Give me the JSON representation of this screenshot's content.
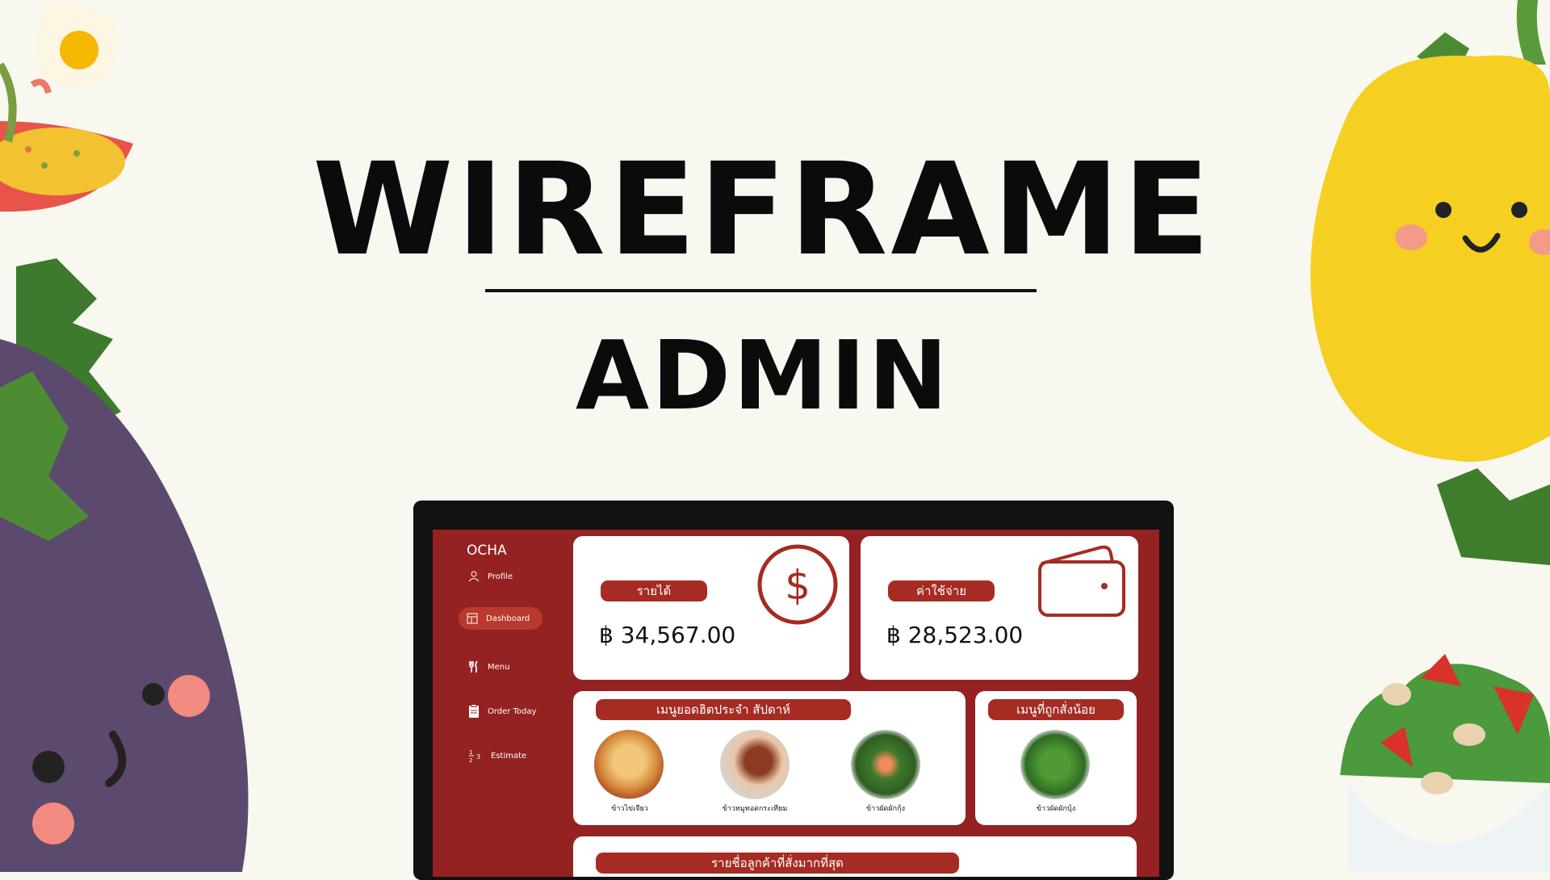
{
  "hero": {
    "title": "WIREFRAME",
    "subtitle": "ADMIN"
  },
  "app": {
    "brand": "OCHA"
  },
  "sidebar": {
    "items": [
      {
        "label": "Profile",
        "icon": "person-icon"
      },
      {
        "label": "Dashboard",
        "icon": "dashboard-icon",
        "active": true
      },
      {
        "label": "Menu",
        "icon": "fork-knife-icon"
      },
      {
        "label": "Order Today",
        "icon": "clipboard-icon"
      },
      {
        "label": "Estimate",
        "icon": "fraction-icon"
      }
    ]
  },
  "cards": {
    "income": {
      "label": "รายได้",
      "amount": "฿ 34,567.00",
      "icon": "dollar-circle-icon"
    },
    "expense": {
      "label": "ค่าใช้จ่าย",
      "amount": "฿ 28,523.00",
      "icon": "wallet-icon"
    },
    "popular": {
      "label": "เมนูยอดฮิตประจำ สัปดาห์",
      "items": [
        {
          "name": "ข้าวไข่เจียว"
        },
        {
          "name": "ข้าวหมูทอดกระเทียม"
        },
        {
          "name": "ข้าวผัดผักกุ้ง"
        }
      ]
    },
    "least": {
      "label": "เมนูที่ถูกสั่งน้อย",
      "items": [
        {
          "name": "ข้าวผัดผักบุ้ง"
        }
      ]
    },
    "customers": {
      "label": "รายชื่อลูกค้าที่สั่งมากที่สุด"
    }
  },
  "colors": {
    "primary": "#942222",
    "pill": "#a62b22",
    "background": "#f8f8f0"
  }
}
